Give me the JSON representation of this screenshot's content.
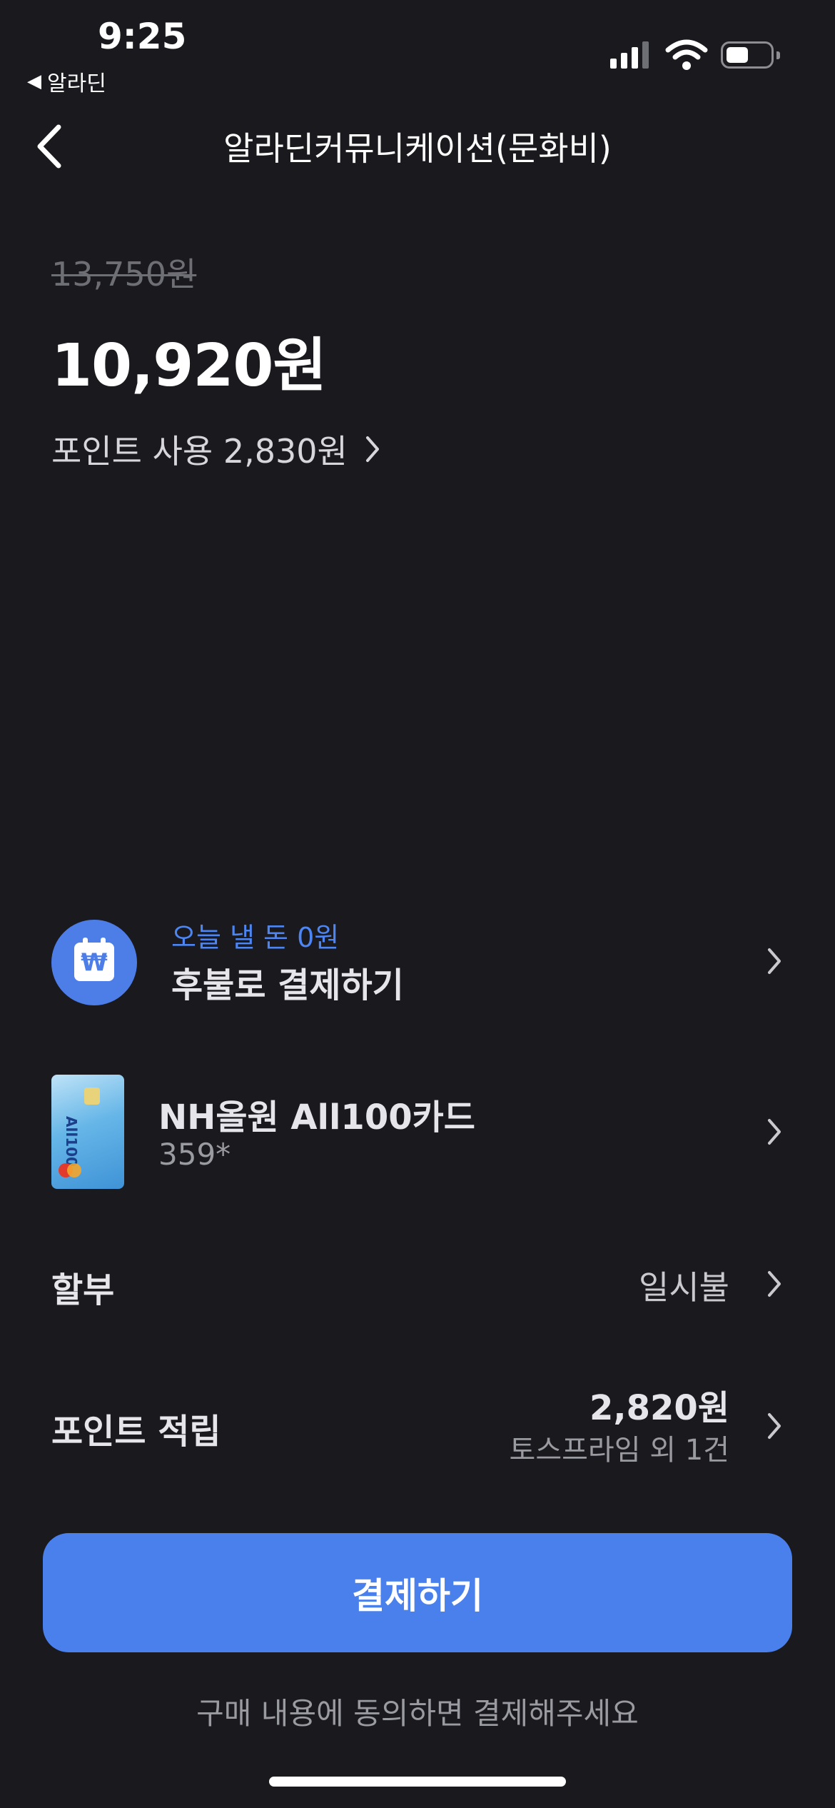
{
  "status_bar": {
    "time": "9:25",
    "back_app_label": "알라딘",
    "icons": [
      "signal-icon",
      "wifi-icon",
      "battery-icon"
    ]
  },
  "nav": {
    "title": "알라딘커뮤니케이션(문화비)",
    "back_icon": "chevron-left-icon"
  },
  "price": {
    "original": "13,750원",
    "final": "10,920원",
    "points_used": "포인트 사용 2,830원"
  },
  "bnpl": {
    "subtitle": "오늘 낼 돈 0원",
    "title": "후불로 결제하기",
    "icon_symbol": "₩"
  },
  "card": {
    "name": "NH올원 All100카드",
    "number": "359*",
    "brand_text": "All100"
  },
  "installment": {
    "label": "할부",
    "value": "일시불"
  },
  "accrual": {
    "label": "포인트 적립",
    "amount": "2,820원",
    "detail": "토스프라임 외 1건"
  },
  "actions": {
    "pay_label": "결제하기",
    "agreement_text": "구매 내용에 동의하면 결제해주세요"
  },
  "colors": {
    "background": "#19191e",
    "accent": "#4a80ec",
    "accent_text": "#4d86f2"
  }
}
